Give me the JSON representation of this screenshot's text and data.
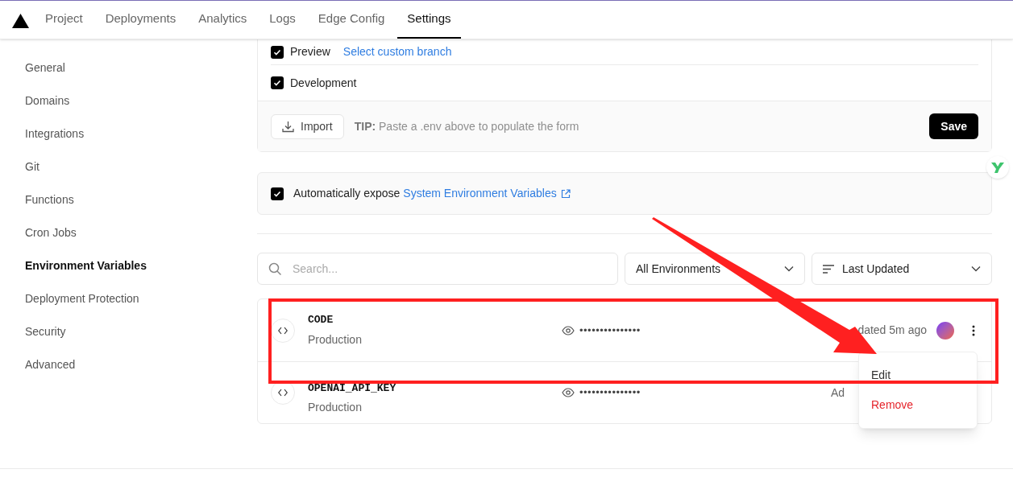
{
  "nav": {
    "tabs": [
      {
        "label": "Project",
        "selected": false
      },
      {
        "label": "Deployments",
        "selected": false
      },
      {
        "label": "Analytics",
        "selected": false
      },
      {
        "label": "Logs",
        "selected": false
      },
      {
        "label": "Edge Config",
        "selected": false
      },
      {
        "label": "Settings",
        "selected": true
      }
    ]
  },
  "sidebar": {
    "items": [
      {
        "label": "General",
        "selected": false
      },
      {
        "label": "Domains",
        "selected": false
      },
      {
        "label": "Integrations",
        "selected": false
      },
      {
        "label": "Git",
        "selected": false
      },
      {
        "label": "Functions",
        "selected": false
      },
      {
        "label": "Cron Jobs",
        "selected": false
      },
      {
        "label": "Environment Variables",
        "selected": true
      },
      {
        "label": "Deployment Protection",
        "selected": false
      },
      {
        "label": "Security",
        "selected": false
      },
      {
        "label": "Advanced",
        "selected": false
      }
    ]
  },
  "environments": [
    {
      "label": "Preview",
      "checked": true,
      "link": "Select custom branch"
    },
    {
      "label": "Development",
      "checked": true
    }
  ],
  "form_footer": {
    "import_button": "Import",
    "tip_label": "TIP:",
    "tip_text": "Paste a .env above to populate the form",
    "save_button": "Save"
  },
  "system_env": {
    "checked": true,
    "text": "Automatically expose",
    "link": "System Environment Variables"
  },
  "filters": {
    "search_placeholder": "Search...",
    "environment": "All Environments",
    "sort": "Last Updated"
  },
  "variables": [
    {
      "name": "CODE",
      "environment": "Production",
      "value": "•••••••••••••••",
      "updated": "dated 5m ago"
    },
    {
      "name": "OPENAI_API_KEY",
      "environment": "Production",
      "value": "•••••••••••••••",
      "updated": "Ad"
    }
  ],
  "menu": {
    "items": [
      {
        "label": "Edit",
        "kind": "default"
      },
      {
        "label": "Remove",
        "kind": "danger"
      }
    ]
  }
}
